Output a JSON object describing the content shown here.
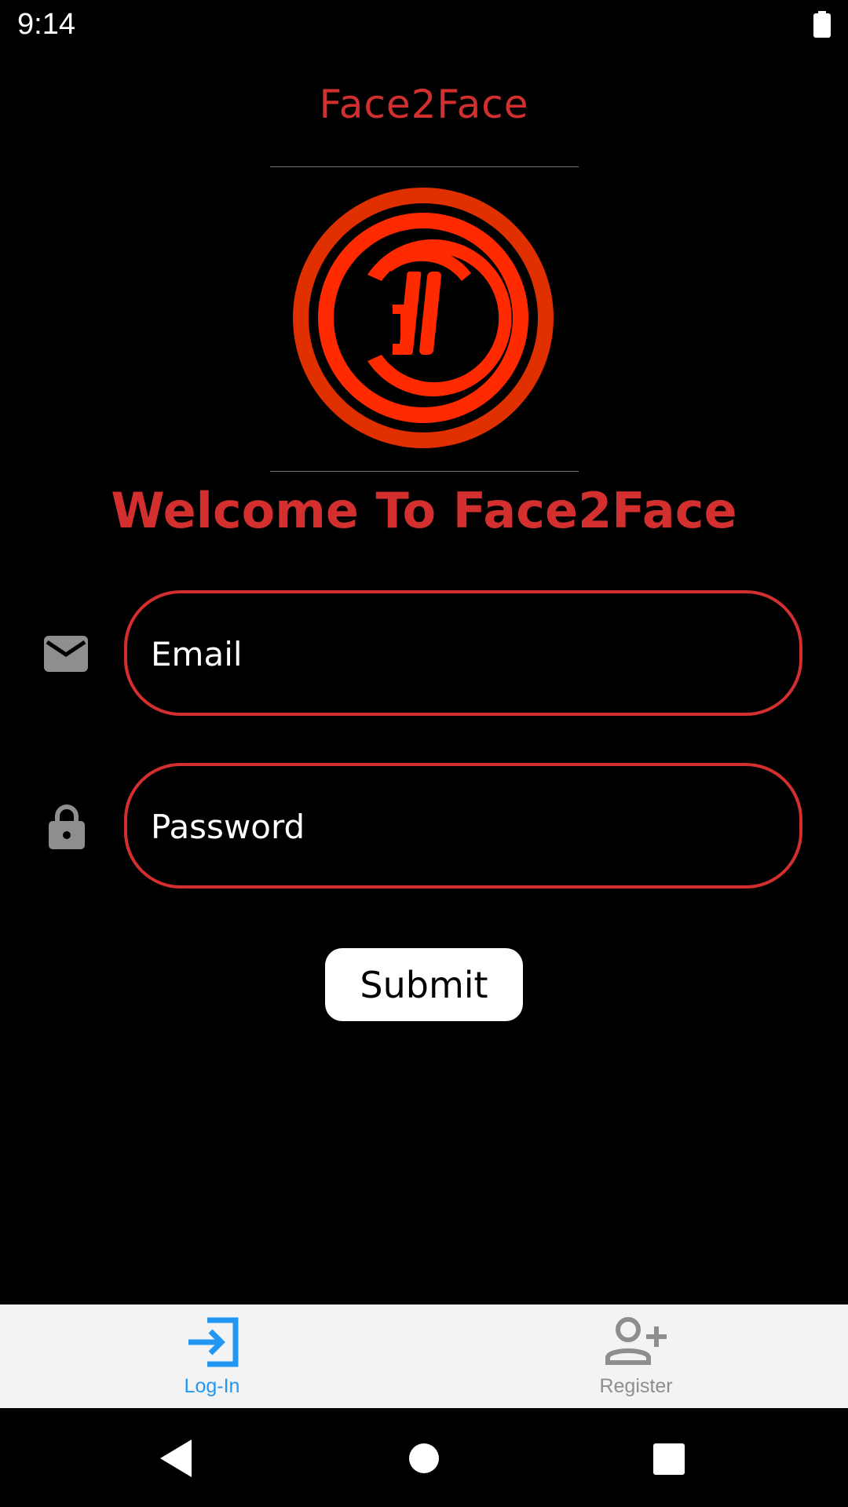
{
  "status_bar": {
    "time": "9:14",
    "battery_icon": "battery-full-icon"
  },
  "header": {
    "app_title": "Face2Face",
    "logo_icon": "face2face-logo"
  },
  "welcome_text": "Welcome To Face2Face",
  "form": {
    "email": {
      "placeholder": "Email",
      "value": "",
      "icon": "mail-icon"
    },
    "password": {
      "placeholder": "Password",
      "value": "",
      "icon": "lock-icon"
    },
    "submit_label": "Submit"
  },
  "tabs": [
    {
      "label": "Log-In",
      "icon": "login-icon",
      "active": true,
      "color": "#2196f3"
    },
    {
      "label": "Register",
      "icon": "add-person-icon",
      "active": false,
      "color": "#8e8e8e"
    }
  ],
  "nav_bar": {
    "back_icon": "back-triangle-icon",
    "home_icon": "home-circle-icon",
    "recents_icon": "recents-square-icon"
  },
  "colors": {
    "accent": "#d32f2f",
    "background": "#000000",
    "logo_red": "#ff2a00",
    "tab_active": "#2196f3",
    "tab_inactive": "#8e8e8e"
  }
}
